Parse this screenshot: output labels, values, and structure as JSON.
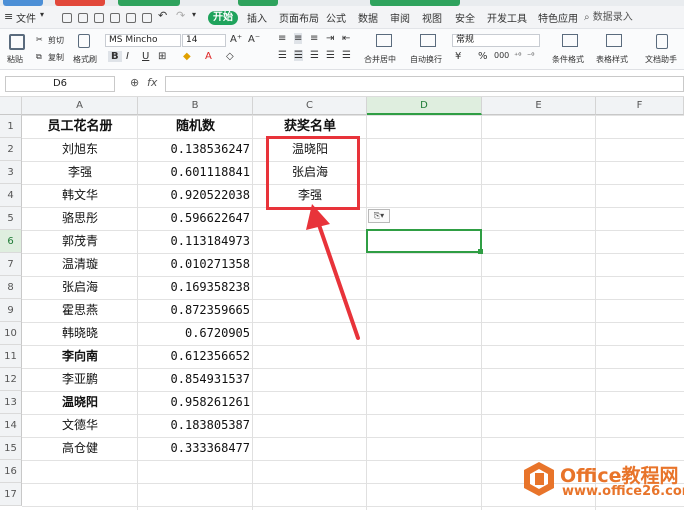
{
  "menubar": {
    "file": "文件",
    "start": "开始",
    "tabs": [
      "插入",
      "页面布局",
      "公式",
      "数据",
      "审阅",
      "视图",
      "安全",
      "开发工具",
      "特色应用"
    ],
    "search": "数据录入"
  },
  "ribbon": {
    "paste": "粘贴",
    "cut": "剪切",
    "copy": "复制",
    "format_painter": "格式刷",
    "font_name": "MS Mincho",
    "font_size": "14",
    "merge_center": "合并居中",
    "wrap": "自动换行",
    "number_format": "常规",
    "conditional_format": "条件格式",
    "table_style": "表格样式",
    "doc_helper": "文档助手",
    "font_grow": "A⁺",
    "font_shrink": "A⁻",
    "bold": "B",
    "italic": "I",
    "underline": "U",
    "percent": "%",
    "thousands": "000"
  },
  "formula_bar": {
    "cell_ref": "D6",
    "fx": "fx",
    "value": ""
  },
  "columns": [
    "A",
    "B",
    "C",
    "D",
    "E",
    "F"
  ],
  "rows": [
    "1",
    "2",
    "3",
    "4",
    "5",
    "6",
    "7",
    "8",
    "9",
    "10",
    "11",
    "12",
    "13",
    "14",
    "15",
    "16",
    "17"
  ],
  "headers": {
    "a1": "员工花名册",
    "b1": "随机数",
    "c1": "获奖名单"
  },
  "employees": [
    "刘旭东",
    "李强",
    "韩文华",
    "骆思彤",
    "郭茂青",
    "温清璇",
    "张启海",
    "霍思燕",
    "韩晓晓",
    "李向南",
    "李亚鹏",
    "温晓阳",
    "文德华",
    "高仓健"
  ],
  "random_numbers": [
    "0.138536247",
    "0.601118841",
    "0.920522038",
    "0.596622647",
    "0.113184973",
    "0.010271358",
    "0.169358238",
    "0.872359665",
    "0.6720905",
    "0.612356652",
    "0.854931537",
    "0.958261261",
    "0.183805387",
    "0.333368477"
  ],
  "winners": [
    "温晓阳",
    "张启海",
    "李强"
  ],
  "paste_options_label": "⎘▾",
  "watermark": {
    "brand": "Office教程网",
    "url": "www.office26.com"
  },
  "colors": {
    "accent_green": "#1fa35c",
    "annotation_red": "#e8333a",
    "watermark_orange": "#e8742a"
  }
}
